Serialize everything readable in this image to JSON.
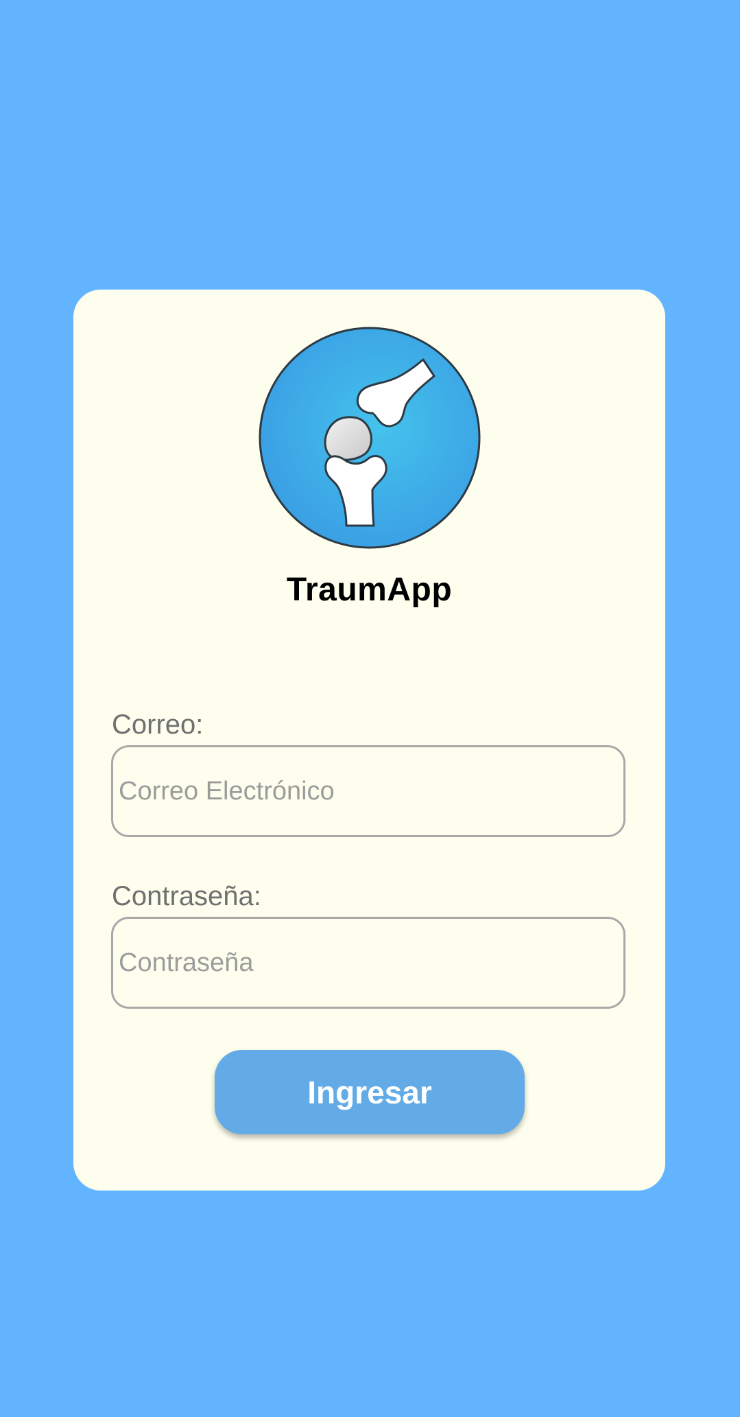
{
  "app": {
    "name": "TraumApp",
    "logo_icon": "knee-joint-icon"
  },
  "form": {
    "email_label": "Correo:",
    "email_placeholder": "Correo Electrónico",
    "email_value": "",
    "password_label": "Contraseña:",
    "password_placeholder": "Contraseña",
    "password_value": "",
    "submit_label": "Ingresar"
  },
  "colors": {
    "background": "#63b4fe",
    "card": "#fefeee",
    "button": "#63abe6",
    "logo_circle": "#3fa7e6"
  }
}
